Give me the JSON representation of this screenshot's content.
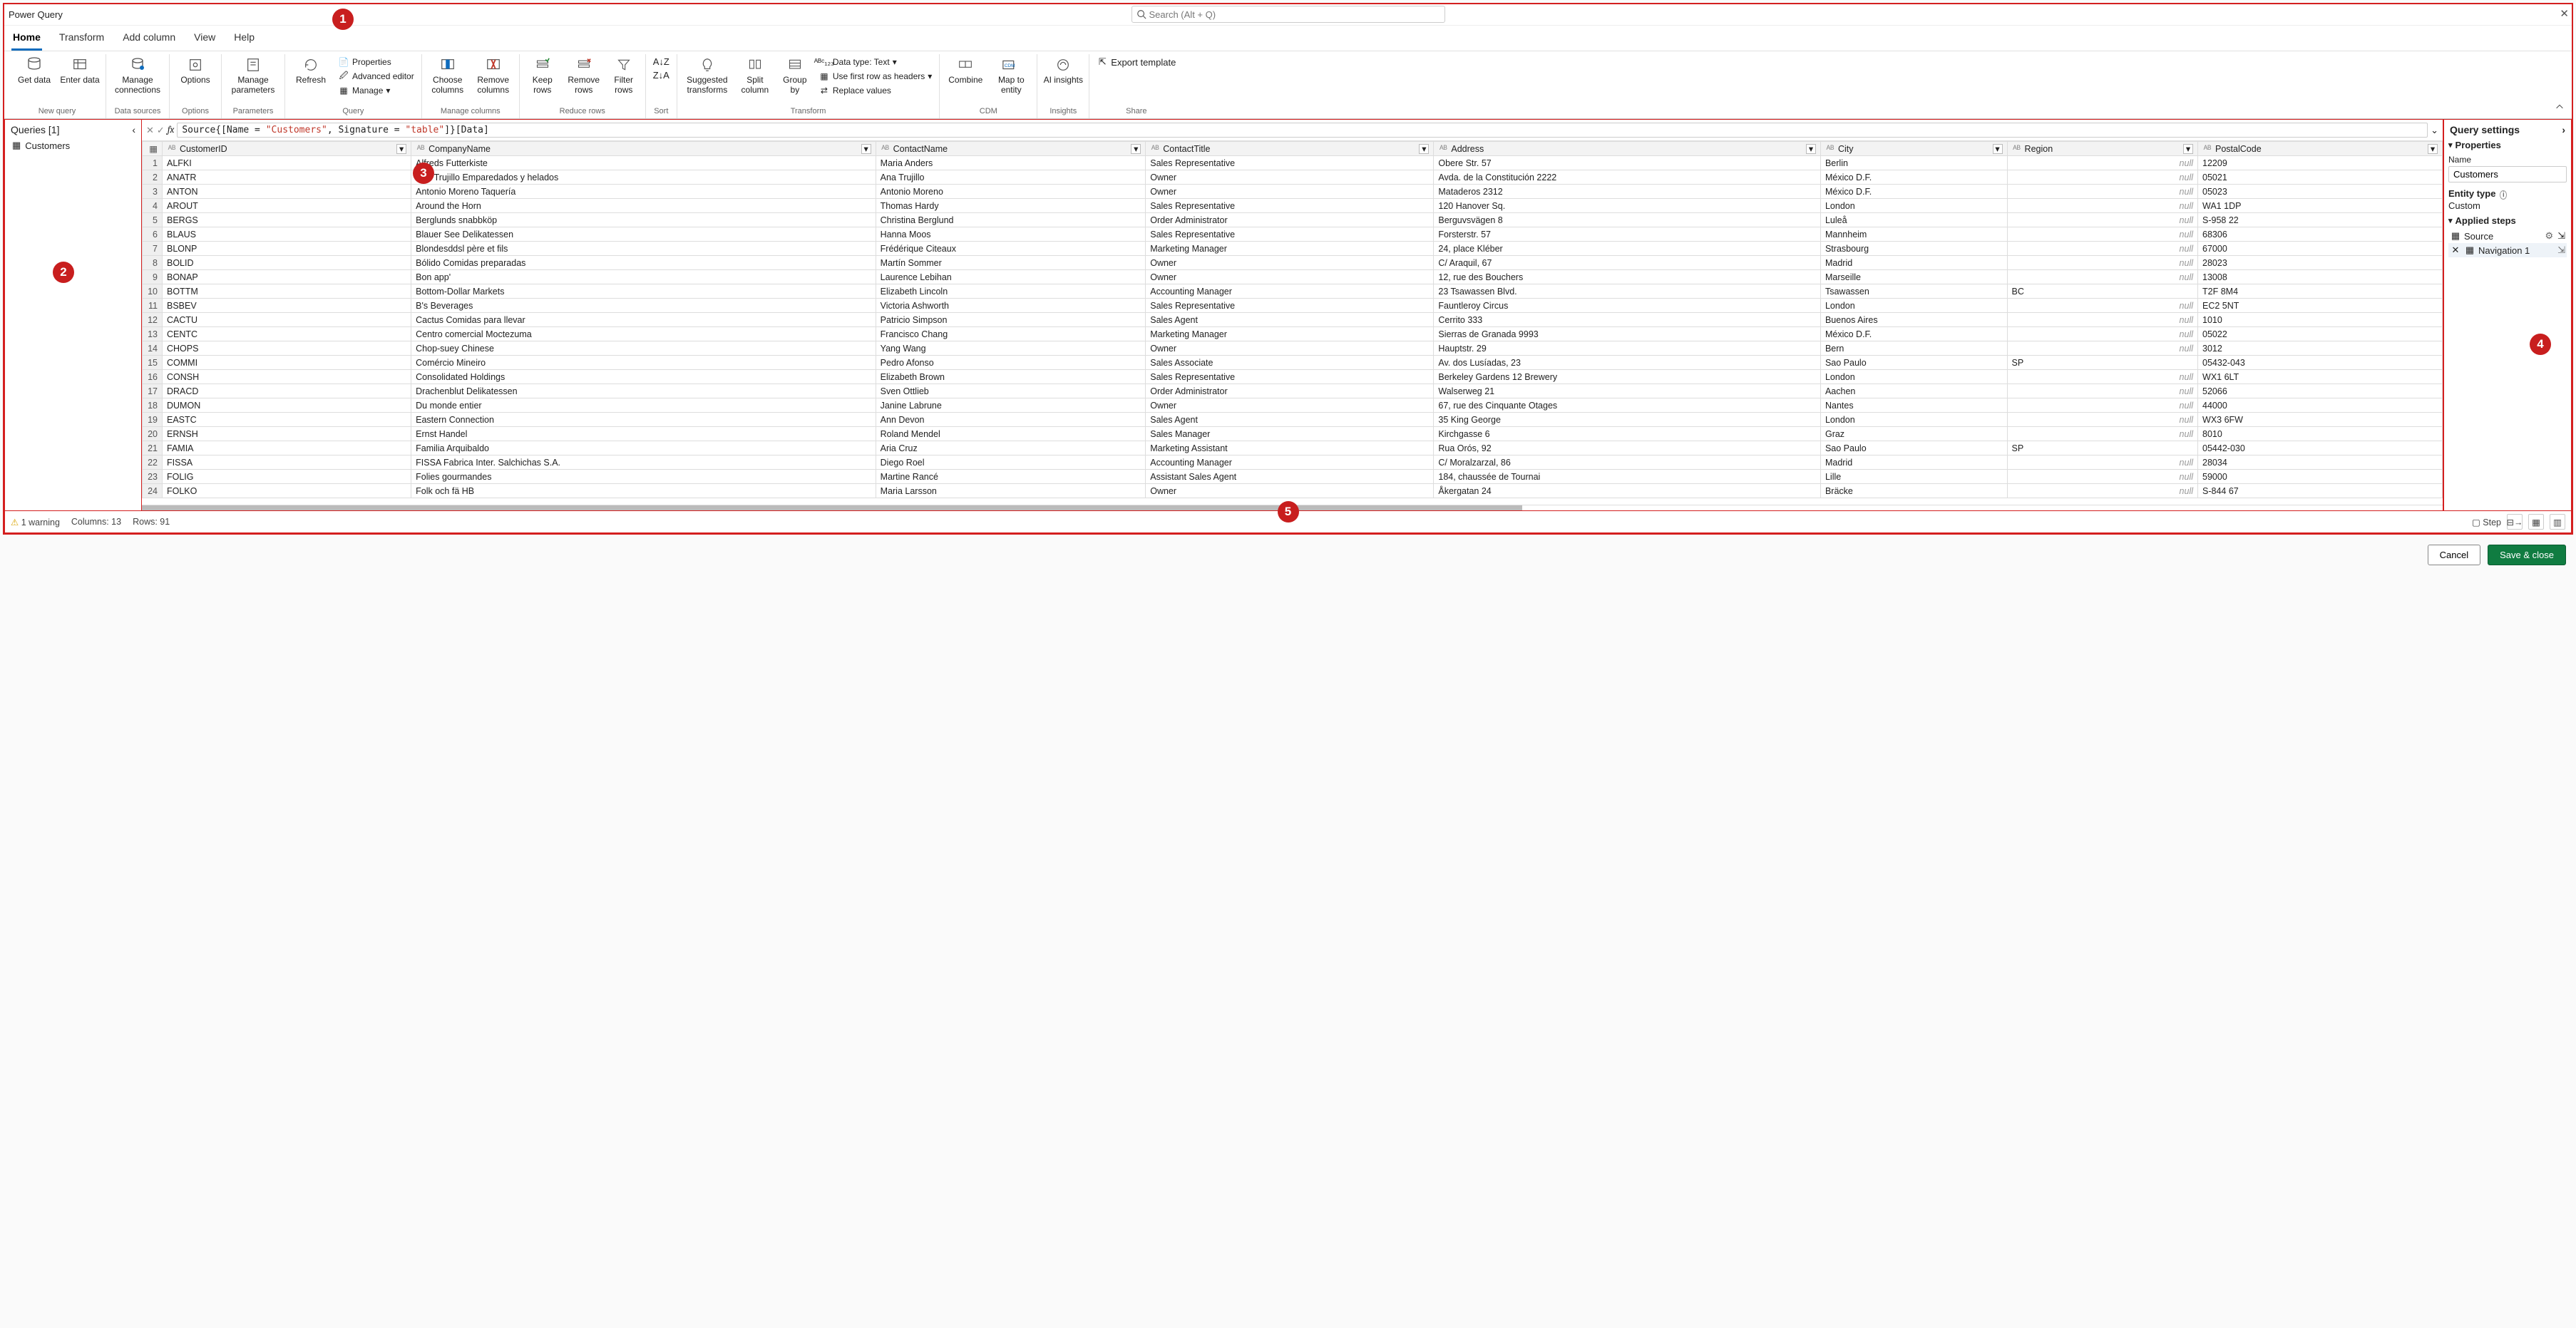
{
  "title": "Power Query",
  "search_placeholder": "Search (Alt + Q)",
  "tabs": [
    "Home",
    "Transform",
    "Add column",
    "View",
    "Help"
  ],
  "active_tab": 0,
  "ribbon": {
    "new_query": {
      "label": "New query",
      "get_data": "Get\ndata",
      "enter_data": "Enter\ndata"
    },
    "data_sources": {
      "label": "Data sources",
      "manage_connections": "Manage\nconnections"
    },
    "options": {
      "label": "Options",
      "options_btn": "Options"
    },
    "parameters": {
      "label": "Parameters",
      "manage_parameters": "Manage\nparameters"
    },
    "query": {
      "label": "Query",
      "refresh": "Refresh",
      "properties": "Properties",
      "advanced": "Advanced editor",
      "manage": "Manage"
    },
    "manage_columns": {
      "label": "Manage columns",
      "choose": "Choose\ncolumns",
      "remove": "Remove\ncolumns"
    },
    "reduce_rows": {
      "label": "Reduce rows",
      "keep": "Keep\nrows",
      "remove": "Remove\nrows",
      "filter": "Filter\nrows"
    },
    "sort": {
      "label": "Sort"
    },
    "transform": {
      "label": "Transform",
      "suggested": "Suggested\ntransforms",
      "split": "Split\ncolumn",
      "group": "Group\nby",
      "data_type": "Data type: Text",
      "first_row": "Use first row as headers",
      "replace": "Replace values"
    },
    "cdm": {
      "label": "CDM",
      "combine": "Combine",
      "map": "Map to\nentity"
    },
    "insights": {
      "label": "Insights",
      "ai": "AI\ninsights"
    },
    "share": {
      "label": "Share",
      "export": "Export template"
    }
  },
  "queries_panel": {
    "title": "Queries [1]",
    "items": [
      "Customers"
    ]
  },
  "formula_parts": {
    "pre": "Source{[Name = ",
    "s1": "\"Customers\"",
    "mid": ", Signature = ",
    "s2": "\"table\"",
    "post": "]}[Data]"
  },
  "columns": [
    "CustomerID",
    "CompanyName",
    "ContactName",
    "ContactTitle",
    "Address",
    "City",
    "Region",
    "PostalCode"
  ],
  "rows": [
    [
      "ALFKI",
      "Alfreds Futterkiste",
      "Maria Anders",
      "Sales Representative",
      "Obere Str. 57",
      "Berlin",
      null,
      "12209"
    ],
    [
      "ANATR",
      "Ana Trujillo Emparedados y helados",
      "Ana Trujillo",
      "Owner",
      "Avda. de la Constitución 2222",
      "México D.F.",
      null,
      "05021"
    ],
    [
      "ANTON",
      "Antonio Moreno Taquería",
      "Antonio Moreno",
      "Owner",
      "Mataderos  2312",
      "México D.F.",
      null,
      "05023"
    ],
    [
      "AROUT",
      "Around the Horn",
      "Thomas Hardy",
      "Sales Representative",
      "120 Hanover Sq.",
      "London",
      null,
      "WA1 1DP"
    ],
    [
      "BERGS",
      "Berglunds snabbköp",
      "Christina Berglund",
      "Order Administrator",
      "Berguvsvägen  8",
      "Luleå",
      null,
      "S-958 22"
    ],
    [
      "BLAUS",
      "Blauer See Delikatessen",
      "Hanna Moos",
      "Sales Representative",
      "Forsterstr. 57",
      "Mannheim",
      null,
      "68306"
    ],
    [
      "BLONP",
      "Blondesddsl père et fils",
      "Frédérique Citeaux",
      "Marketing Manager",
      "24, place Kléber",
      "Strasbourg",
      null,
      "67000"
    ],
    [
      "BOLID",
      "Bólido Comidas preparadas",
      "Martín Sommer",
      "Owner",
      "C/ Araquil, 67",
      "Madrid",
      null,
      "28023"
    ],
    [
      "BONAP",
      "Bon app'",
      "Laurence Lebihan",
      "Owner",
      "12, rue des Bouchers",
      "Marseille",
      null,
      "13008"
    ],
    [
      "BOTTM",
      "Bottom-Dollar Markets",
      "Elizabeth Lincoln",
      "Accounting Manager",
      "23 Tsawassen Blvd.",
      "Tsawassen",
      "BC",
      "T2F 8M4"
    ],
    [
      "BSBEV",
      "B's Beverages",
      "Victoria Ashworth",
      "Sales Representative",
      "Fauntleroy Circus",
      "London",
      null,
      "EC2 5NT"
    ],
    [
      "CACTU",
      "Cactus Comidas para llevar",
      "Patricio Simpson",
      "Sales Agent",
      "Cerrito 333",
      "Buenos Aires",
      null,
      "1010"
    ],
    [
      "CENTC",
      "Centro comercial Moctezuma",
      "Francisco Chang",
      "Marketing Manager",
      "Sierras de Granada 9993",
      "México D.F.",
      null,
      "05022"
    ],
    [
      "CHOPS",
      "Chop-suey Chinese",
      "Yang Wang",
      "Owner",
      "Hauptstr. 29",
      "Bern",
      null,
      "3012"
    ],
    [
      "COMMI",
      "Comércio Mineiro",
      "Pedro Afonso",
      "Sales Associate",
      "Av. dos Lusíadas, 23",
      "Sao Paulo",
      "SP",
      "05432-043"
    ],
    [
      "CONSH",
      "Consolidated Holdings",
      "Elizabeth Brown",
      "Sales Representative",
      "Berkeley Gardens 12  Brewery",
      "London",
      null,
      "WX1 6LT"
    ],
    [
      "DRACD",
      "Drachenblut Delikatessen",
      "Sven Ottlieb",
      "Order Administrator",
      "Walserweg 21",
      "Aachen",
      null,
      "52066"
    ],
    [
      "DUMON",
      "Du monde entier",
      "Janine Labrune",
      "Owner",
      "67, rue des Cinquante Otages",
      "Nantes",
      null,
      "44000"
    ],
    [
      "EASTC",
      "Eastern Connection",
      "Ann Devon",
      "Sales Agent",
      "35 King George",
      "London",
      null,
      "WX3 6FW"
    ],
    [
      "ERNSH",
      "Ernst Handel",
      "Roland Mendel",
      "Sales Manager",
      "Kirchgasse 6",
      "Graz",
      null,
      "8010"
    ],
    [
      "FAMIA",
      "Familia Arquibaldo",
      "Aria Cruz",
      "Marketing Assistant",
      "Rua Orós, 92",
      "Sao Paulo",
      "SP",
      "05442-030"
    ],
    [
      "FISSA",
      "FISSA Fabrica Inter. Salchichas S.A.",
      "Diego Roel",
      "Accounting Manager",
      "C/ Moralzarzal, 86",
      "Madrid",
      null,
      "28034"
    ],
    [
      "FOLIG",
      "Folies gourmandes",
      "Martine Rancé",
      "Assistant Sales Agent",
      "184, chaussée de Tournai",
      "Lille",
      null,
      "59000"
    ],
    [
      "FOLKO",
      "Folk och fä HB",
      "Maria Larsson",
      "Owner",
      "Åkergatan 24",
      "Bräcke",
      null,
      "S-844 67"
    ]
  ],
  "null_text": "null",
  "settings": {
    "title": "Query settings",
    "properties": "Properties",
    "name_label": "Name",
    "name_value": "Customers",
    "entity_type_label": "Entity type",
    "entity_type_value": "Custom",
    "steps_label": "Applied steps",
    "steps": [
      "Source",
      "Navigation 1"
    ]
  },
  "status": {
    "warnings": "1 warning",
    "columns": "Columns: 13",
    "rows": "Rows: 91",
    "step": "Step"
  },
  "footer": {
    "cancel": "Cancel",
    "save": "Save & close"
  },
  "callouts": [
    "1",
    "2",
    "3",
    "4",
    "5"
  ]
}
